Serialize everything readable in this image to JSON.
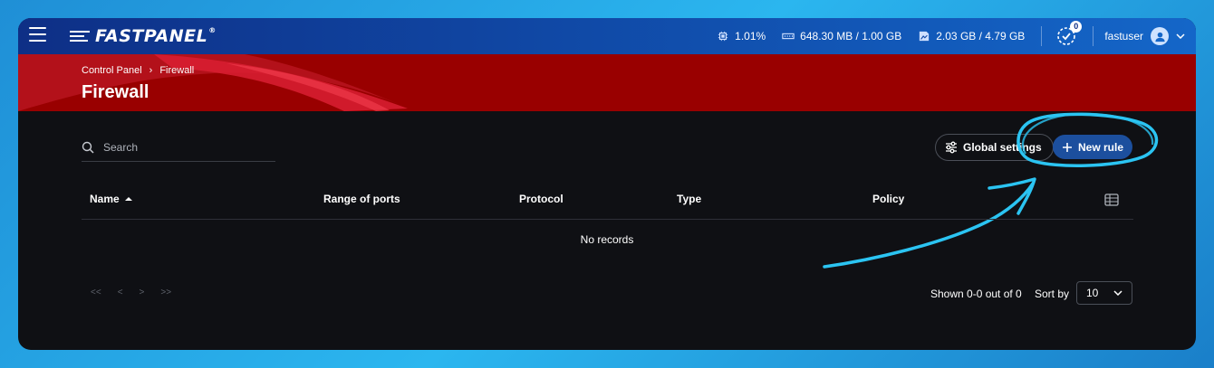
{
  "topbar": {
    "brand": "FASTPANEL",
    "brand_reg": "®",
    "cpu": "1.01%",
    "ram": "648.30 MB / 1.00 GB",
    "disk": "2.03 GB / 4.79 GB",
    "notifications": "0",
    "username": "fastuser"
  },
  "breadcrumb": {
    "root": "Control Panel",
    "separator": "›",
    "current": "Firewall"
  },
  "page": {
    "title": "Firewall"
  },
  "toolbar": {
    "search_placeholder": "Search",
    "global_settings_label": "Global settings",
    "new_rule_label": "New rule"
  },
  "table": {
    "columns": [
      "Name",
      "Range of ports",
      "Protocol",
      "Type",
      "Policy"
    ],
    "empty_text": "No records"
  },
  "pagination": {
    "first": "<<",
    "prev": "<",
    "next": ">",
    "last": ">>",
    "shown_text": "Shown 0-0 out of 0",
    "sort_label": "Sort by",
    "page_size": "10"
  },
  "colors": {
    "accent": "#1c4f9e",
    "header_red": "#990000",
    "annotation": "#2bc4f2"
  }
}
